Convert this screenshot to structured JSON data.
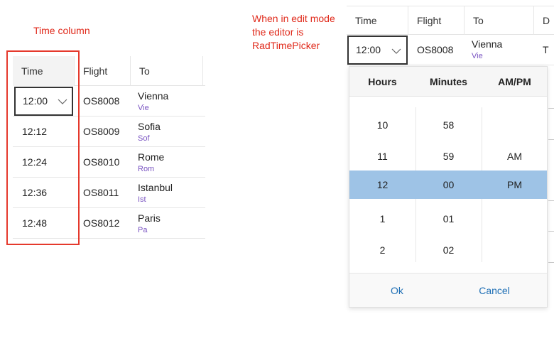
{
  "annotations": {
    "time_column": "Time column",
    "edit_mode_line1": "When in edit mode",
    "edit_mode_line2": "the editor is",
    "edit_mode_line3": "RadTimePicker"
  },
  "left_grid": {
    "columns": {
      "time": "Time",
      "flight": "Flight",
      "to": "To"
    },
    "editor_value": "12:00",
    "rows": [
      {
        "time": "",
        "flight": "OS8008",
        "city": "Vienna",
        "code": "Vie"
      },
      {
        "time": "12:12",
        "flight": "OS8009",
        "city": "Sofia",
        "code": "Sof"
      },
      {
        "time": "12:24",
        "flight": "OS8010",
        "city": "Rome",
        "code": "Rom"
      },
      {
        "time": "12:36",
        "flight": "OS8011",
        "city": "Istanbul",
        "code": "Ist"
      },
      {
        "time": "12:48",
        "flight": "OS8012",
        "city": "Paris",
        "code": "Pa"
      }
    ]
  },
  "right_grid": {
    "columns": {
      "time": "Time",
      "flight": "Flight",
      "to": "To",
      "next": "D"
    },
    "editor_value": "12:00",
    "row": {
      "flight": "OS8008",
      "city": "Vienna",
      "code": "Vie",
      "next": "T"
    }
  },
  "time_picker": {
    "headers": {
      "hours": "Hours",
      "minutes": "Minutes",
      "ampm": "AM/PM"
    },
    "hours": [
      "10",
      "11",
      "12",
      "1",
      "2"
    ],
    "minutes": [
      "58",
      "59",
      "00",
      "01",
      "02"
    ],
    "ampm": [
      "",
      "AM",
      "PM",
      "",
      ""
    ],
    "selected": {
      "hours": "12",
      "minutes": "00",
      "ampm": "PM"
    },
    "ok_label": "Ok",
    "cancel_label": "Cancel",
    "selection_color": "#9ec3e6"
  },
  "colors": {
    "annotation": "#e02a1b",
    "city_code": "#7a54c2",
    "link": "#1e6fb5"
  }
}
